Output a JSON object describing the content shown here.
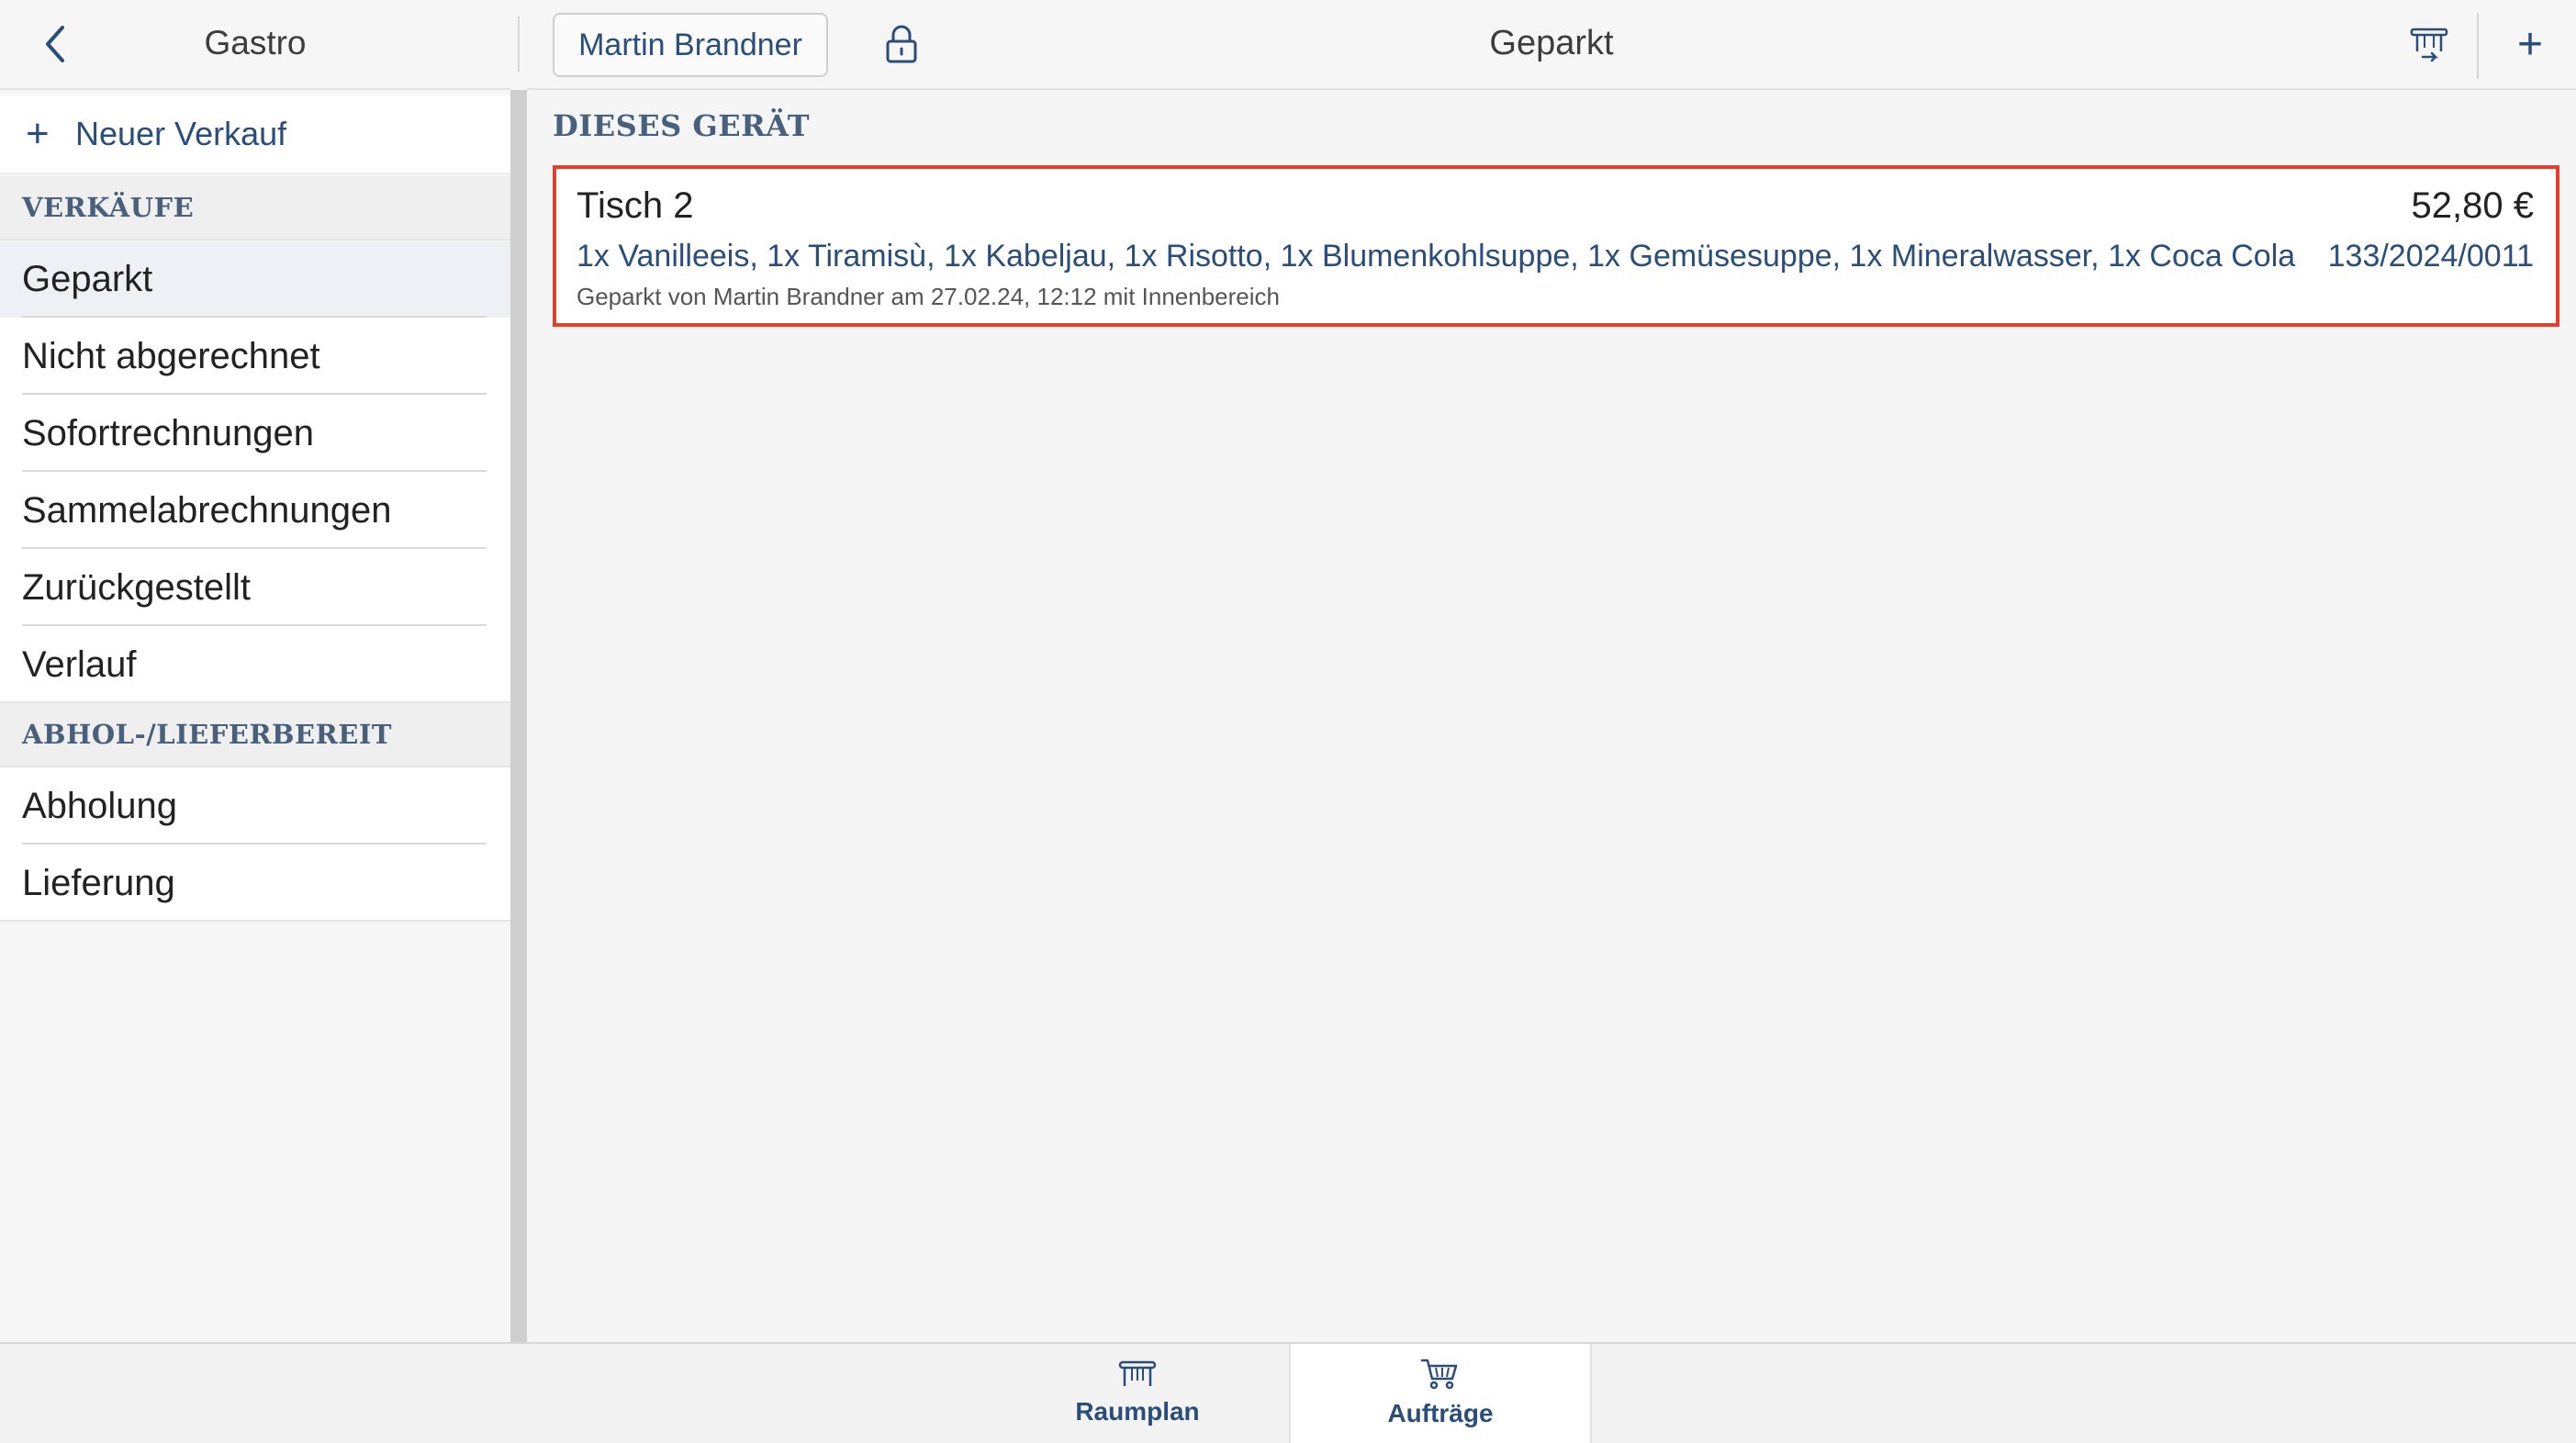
{
  "sidebar": {
    "title": "Gastro",
    "back_icon": "chevron-left-icon",
    "new_sale": {
      "icon": "plus-icon",
      "label": "Neuer Verkauf"
    },
    "sections": [
      {
        "heading": "VERKÄUFE",
        "items": [
          {
            "label": "Geparkt",
            "active": true
          },
          {
            "label": "Nicht abgerechnet"
          },
          {
            "label": "Sofortrechnungen"
          },
          {
            "label": "Sammelabrechnungen"
          },
          {
            "label": "Zurückgestellt"
          },
          {
            "label": "Verlauf"
          }
        ]
      },
      {
        "heading": "ABHOL-/LIEFERBEREIT",
        "items": [
          {
            "label": "Abholung"
          },
          {
            "label": "Lieferung"
          }
        ]
      }
    ]
  },
  "topbar": {
    "user_button": "Martin Brandner",
    "lock_icon": "lock-icon",
    "title": "Geparkt",
    "table_icon": "table-icon",
    "add_icon": "plus-icon",
    "add_label": "+"
  },
  "main": {
    "section_heading": "DIESES GERÄT",
    "orders": [
      {
        "name": "Tisch 2",
        "amount": "52,80 €",
        "items": "1x Vanilleeis, 1x Tiramisù, 1x Kabeljau, 1x Risotto, 1x Blumenkohlsuppe, 1x Gemüsesuppe, 1x Mineralwasser, 1x Coca Cola",
        "number": "133/2024/0011",
        "meta": "Geparkt von Martin Brandner am 27.02.24, 12:12 mit Innenbereich"
      }
    ]
  },
  "tabbar": {
    "tabs": [
      {
        "label": "Raumplan",
        "icon": "table-icon",
        "active": false
      },
      {
        "label": "Aufträge",
        "icon": "cart-icon",
        "active": true
      }
    ]
  },
  "colors": {
    "accent": "#2a4d7a",
    "section_heading": "#48607c",
    "highlight_border": "#e0402c",
    "active_row": "#edf0f5"
  }
}
